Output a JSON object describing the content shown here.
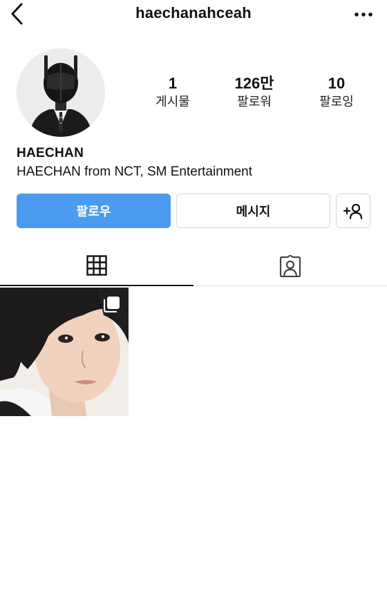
{
  "header": {
    "username": "haechanahceah"
  },
  "profile": {
    "display_name": "HAECHAN",
    "bio": "HAECHAN from NCT, SM Entertainment",
    "stats": {
      "posts": {
        "value": "1",
        "label": "게시물"
      },
      "followers": {
        "value": "126만",
        "label": "팔로워"
      },
      "following": {
        "value": "10",
        "label": "팔로잉"
      }
    }
  },
  "actions": {
    "follow_label": "팔로우",
    "message_label": "메시지",
    "suggest_icon": "add-person-icon"
  },
  "tabs": [
    {
      "icon": "grid-icon",
      "active": true
    },
    {
      "icon": "tagged-icon",
      "active": false
    }
  ],
  "posts": [
    {
      "type": "carousel",
      "icon": "multiple-photos-icon"
    }
  ],
  "colors": {
    "accent": "#4b9cf0",
    "text": "#111111",
    "border": "#d6d6d6"
  }
}
